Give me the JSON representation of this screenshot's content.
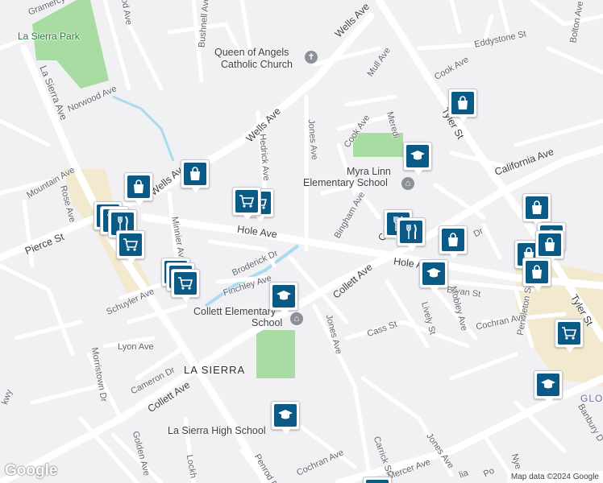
{
  "map": {
    "places": {
      "la_sierra_park": "La Sierra Park",
      "church": [
        "Queen of Angels",
        "Catholic Church"
      ],
      "myra_linn": [
        "Myra Linn",
        "Elementary School"
      ],
      "collett_school": [
        "Collett Elementary",
        "School"
      ],
      "la_sierra_area": "LA SIERRA",
      "la_sierra_high": "La Sierra High School",
      "glo_partial": "GLO"
    },
    "streets": {
      "gramercy": "Gramercy",
      "hood_ave": "ood Ave",
      "bushnell": "Bushnell Ave",
      "wells_ave_1": "Wells Ave",
      "wells_ave_2": "Wells Ave",
      "wells_ave_3": "Wells Ave",
      "la_sierra_ave": "La Sierra Ave",
      "norwood": "Norwood Ave",
      "mull": "Mull Ave",
      "cook_ave_1": "Cook Ave",
      "cook_ave_2": "Cook Ave",
      "eddystone": "Eddystone St",
      "bolton": "Bolton Ave",
      "tyler_1": "Tyler St",
      "tyler_2": "Tyler St",
      "california": "California Ave",
      "california_2": "Cal",
      "meredith": "Meredi",
      "hedrick": "Hedrick Ave",
      "jones_1": "Jones Ave",
      "jones_2": "Jones Ave",
      "jones_3": "Jones Ave",
      "mountain": "Mountain Ave",
      "rose": "Rose Ave",
      "pierce": "Pierce St",
      "hole_1": "Hole Ave",
      "hole_2": "Hole A",
      "bingham": "Bingham Ave",
      "broderick": "Broderick Dr",
      "finchley": "Finchley Ave",
      "minnier": "Minnier Ave",
      "collett_1": "Collett Ave",
      "collett_2": "Collett Ave",
      "schuyler": "Schuyler Ave",
      "lyon": "Lyon Ave",
      "morristown": "Morristown Dr",
      "cameron": "Cameron Dr",
      "bryan": "Bryan St",
      "mobley": "Mobley Ave",
      "lively": "Lively St",
      "cass": "Cass St",
      "pendleton": "Pendleton St",
      "cochran_1": "Cochran Ave",
      "cochran_2": "Cochran Ave",
      "golden": "Golden Ave",
      "penrod": "Penrod D",
      "carrick": "Carrick St",
      "mercer": "Mercer Ave",
      "banbury": "Banbury D",
      "nye": "Nye",
      "lockh": "Lockh",
      "kwy": "kwy",
      "dr_partial": "Dr",
      "lia_partial": "lia",
      "po_partial": "Po"
    },
    "markers": [
      {
        "type": "shopping",
        "icon": "shopping-bag-icon"
      },
      {
        "type": "shopping",
        "icon": "shopping-bag-icon"
      },
      {
        "type": "shopping",
        "icon": "shopping-bag-icon"
      },
      {
        "type": "grocery",
        "icon": "shopping-cart-icon"
      },
      {
        "type": "restaurant",
        "icon": "fork-knife-icon"
      },
      {
        "type": "grocery",
        "icon": "shopping-cart-icon"
      },
      {
        "type": "grocery",
        "icon": "shopping-cart-icon"
      },
      {
        "type": "school",
        "icon": "graduation-cap-icon"
      },
      {
        "type": "school",
        "icon": "graduation-cap-icon"
      },
      {
        "type": "school",
        "icon": "graduation-cap-icon"
      },
      {
        "type": "school",
        "icon": "graduation-cap-icon"
      },
      {
        "type": "school",
        "icon": "graduation-cap-icon"
      },
      {
        "type": "restaurant",
        "icon": "fork-knife-icon"
      },
      {
        "type": "shopping",
        "icon": "shopping-bag-icon"
      },
      {
        "type": "shopping",
        "icon": "shopping-bag-icon"
      },
      {
        "type": "shopping",
        "icon": "shopping-bag-icon"
      },
      {
        "type": "shopping",
        "icon": "shopping-bag-icon"
      },
      {
        "type": "grocery",
        "icon": "shopping-cart-icon"
      },
      {
        "type": "shopping",
        "icon": "shopping-bag-icon"
      }
    ],
    "attribution": "Map data ©2024 Google",
    "logo": "Google",
    "colors": {
      "background": "#f1f1f4",
      "park": "#a8dca2",
      "commercial": "#f3e9cf",
      "water": "#a9dcf0",
      "road": "#ffffff",
      "marker": "#0b5a86"
    }
  }
}
